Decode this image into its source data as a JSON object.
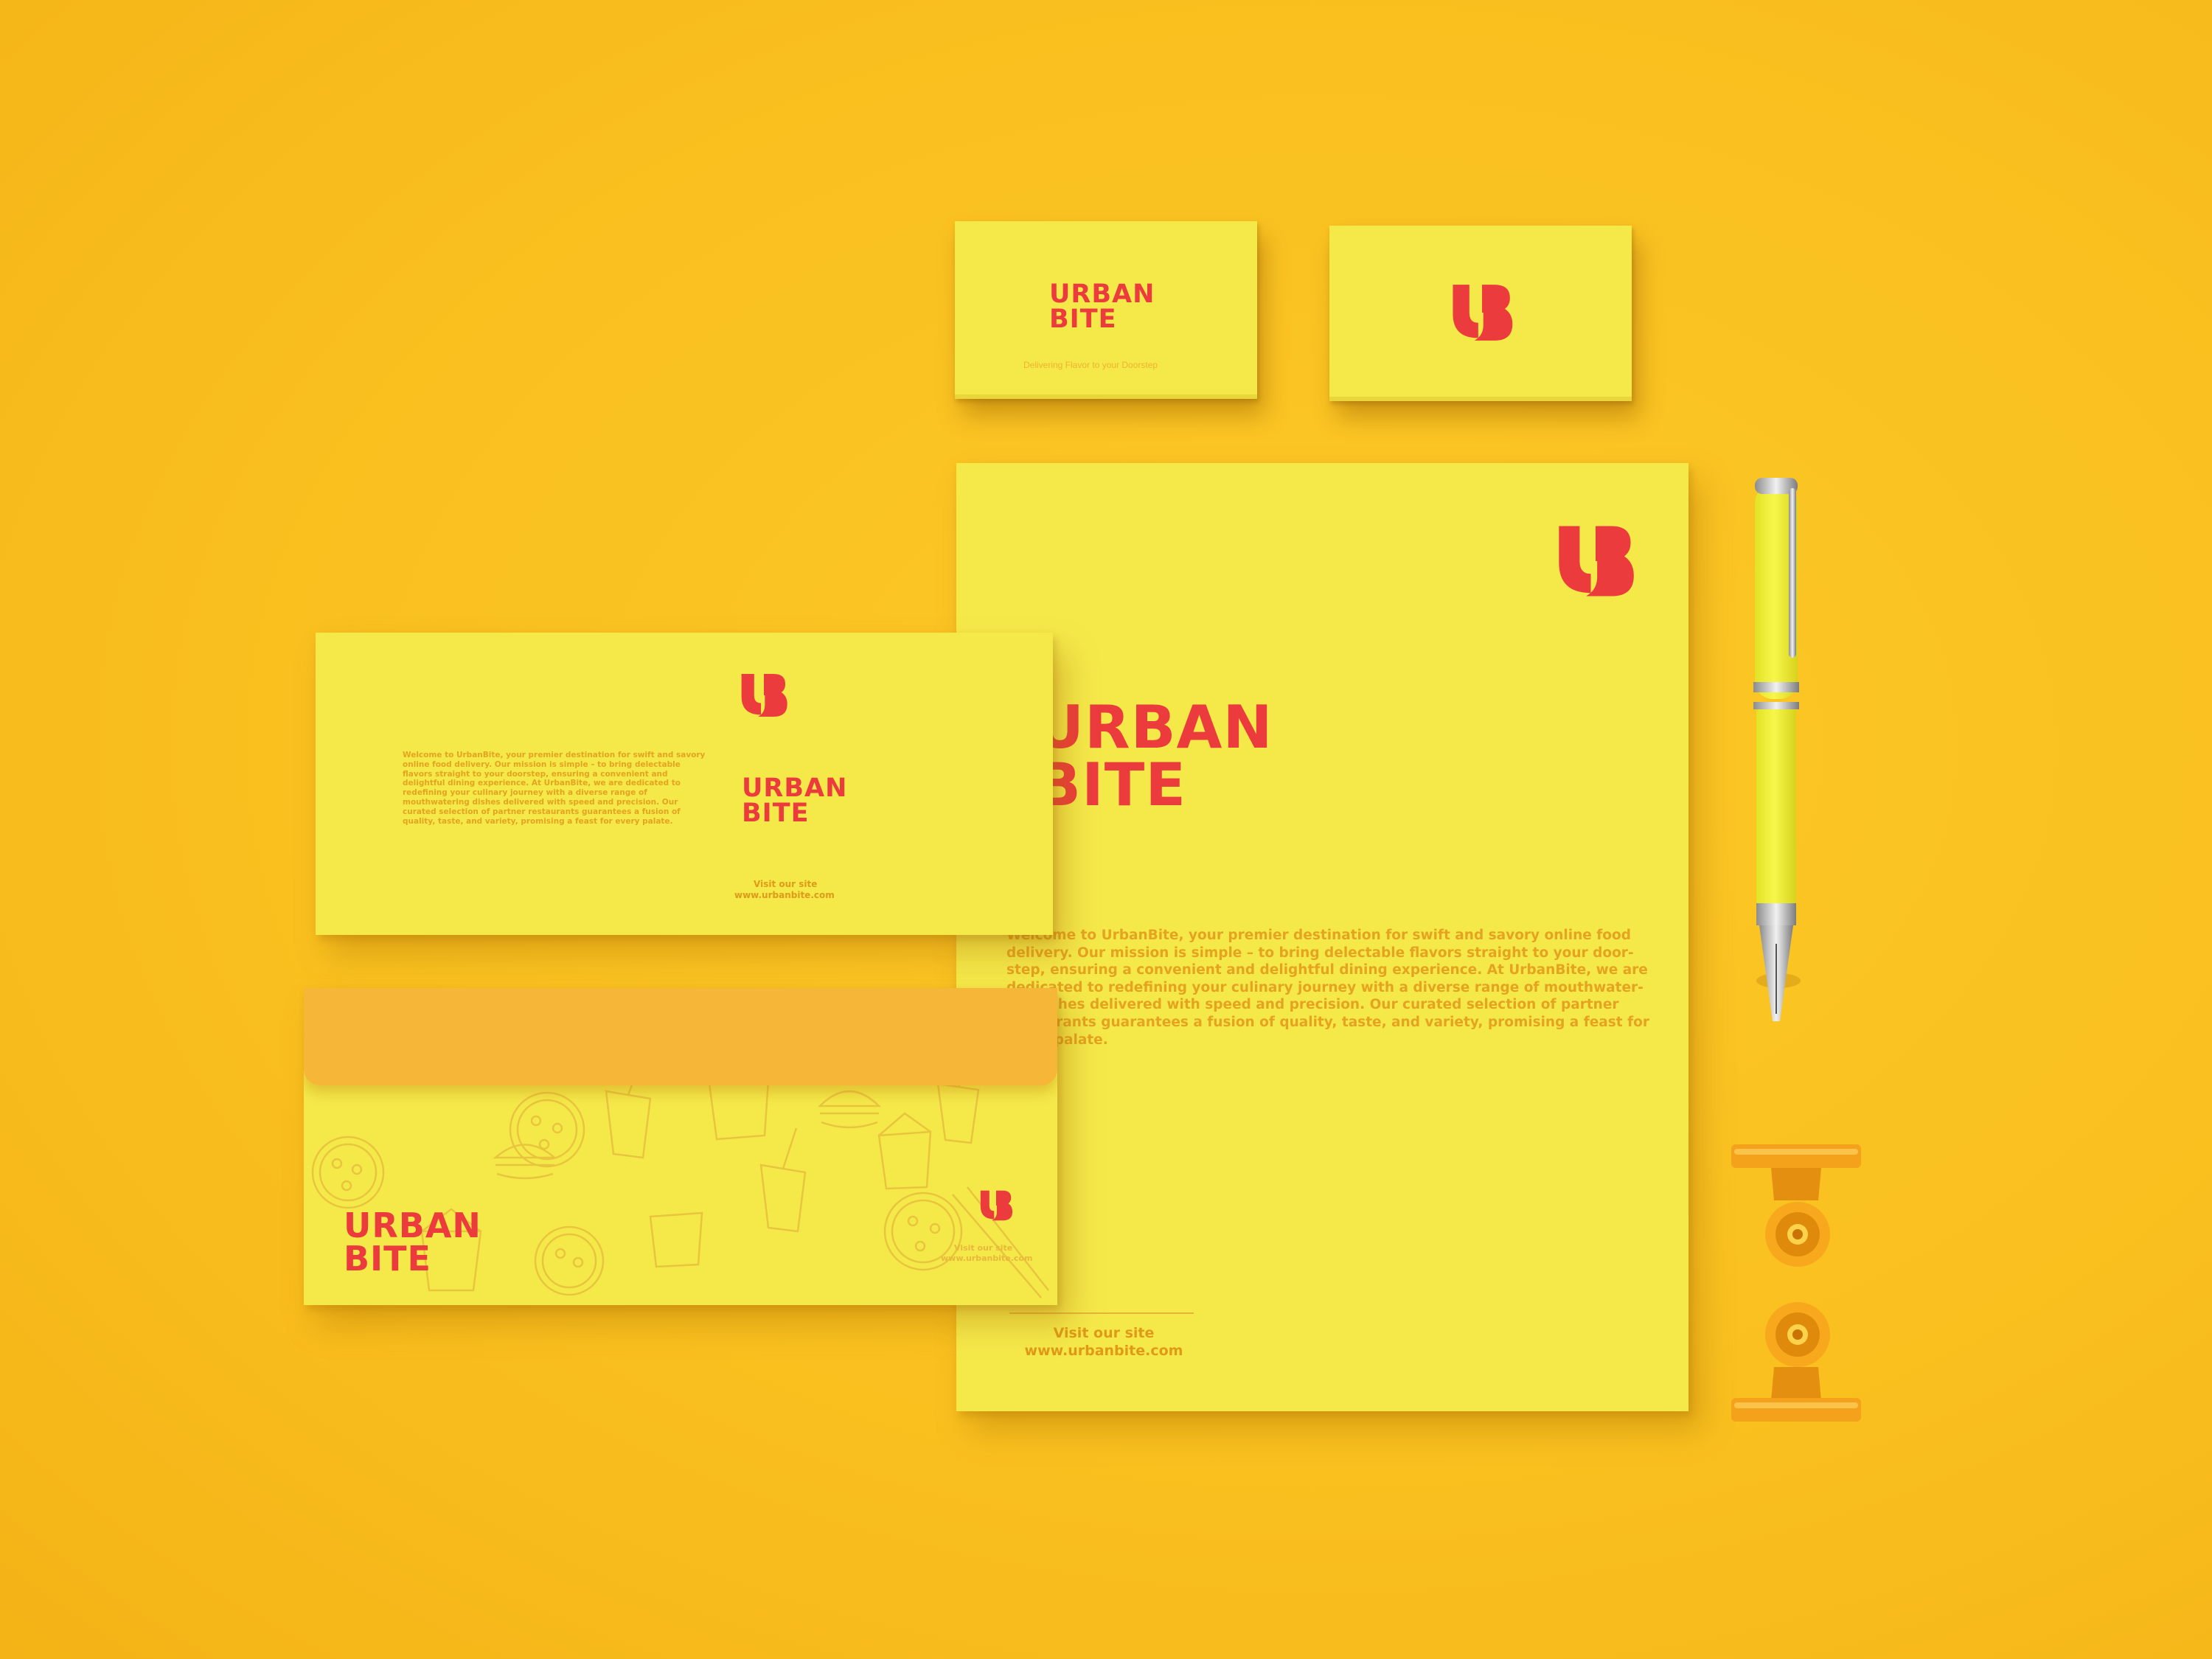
{
  "brand": {
    "line1": "URBAN",
    "line2": "BITE",
    "accent_color": "#ec3b3d",
    "paper_color": "#f5e94a",
    "background_color": "#f9bf1e"
  },
  "card_front": {
    "tagline": "Delivering Flavor to your Doorstep"
  },
  "compliment_slip": {
    "body": "Welcome to UrbanBite, your premier destination for swift and savory online food delivery. Our mission is simple – to bring delectable flavors straight to your doorstep, ensuring a convenient and delightful dining experience. At UrbanBite, we are dedicated to redefining your culinary journey with a diverse range of mouthwatering dishes delivered with speed and precision. Our curated selection of partner restaurants guarantees a fusion of quality, taste, and variety, promising a feast for every palate.",
    "site_label": "Visit our site",
    "site_url": "www.urbanbite.com"
  },
  "envelope": {
    "site_label": "Visit our site",
    "site_url": "www.urbanbite.com",
    "flap_color": "#f6b638"
  },
  "letterhead": {
    "body_line_1": "Welcome to UrbanBite, your premier destination for swift and savory online food",
    "body_line_2": "delivery. Our mission is simple – to bring delectable flavors straight to your door-",
    "body_line_3": "step, ensuring a convenient and delightful dining experience. At UrbanBite, we are",
    "body_line_4": "dedicated to redefining your culinary journey with a diverse range of mouthwater-",
    "body_line_5": "ing dishes delivered with speed and precision. Our curated selection of partner",
    "body_line_6": "restaurants guarantees a fusion of quality, taste, and variety, promising a feast for",
    "body_line_7": "every palate.",
    "site_label": "Visit our site",
    "site_url": "www.urbanbite.com"
  },
  "props": {
    "pen_color": "#f2f23d",
    "clip_color": "#f6a21b"
  }
}
